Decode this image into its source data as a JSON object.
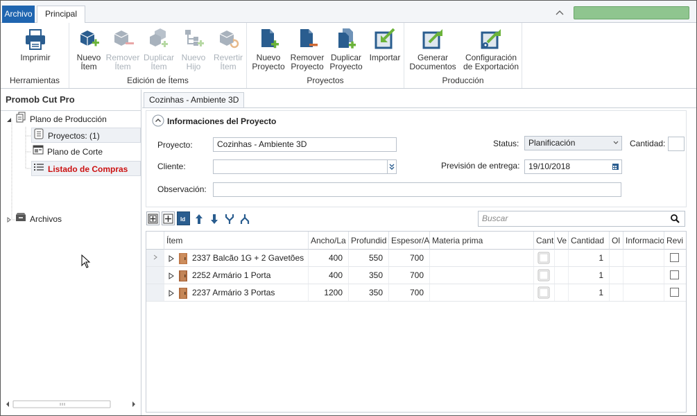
{
  "tabs": {
    "archivo": "Archivo",
    "principal": "Principal"
  },
  "ribbon": {
    "herramientas": {
      "label": "Herramientas",
      "imprimir": "Imprimir"
    },
    "edicion": {
      "label": "Edición de Ítems",
      "nuevo_item": [
        "Nuevo",
        "Ítem"
      ],
      "remover_item": [
        "Remover",
        "Ítem"
      ],
      "duplicar_item": [
        "Duplicar",
        "Ítem"
      ],
      "nuevo_hijo": [
        "Nuevo",
        "Hijo"
      ],
      "revertir_item": [
        "Revertir",
        "Ítem"
      ]
    },
    "proyectos": {
      "label": "Proyectos",
      "nuevo_proyecto": [
        "Nuevo",
        "Proyecto"
      ],
      "remover_proyecto": [
        "Remover",
        "Proyecto"
      ],
      "duplicar_proyecto": [
        "Duplicar",
        "Proyecto"
      ],
      "importar": "Importar"
    },
    "produccion": {
      "label": "Producción",
      "generar": [
        "Generar",
        "Documentos"
      ],
      "configuracion": [
        "Configuración",
        "de Exportación"
      ]
    }
  },
  "left": {
    "title": "Promob Cut Pro",
    "tree": {
      "plano_produccion": "Plano de Producción",
      "proyectos": "Proyectos: (1)",
      "plano_corte": "Plano de Corte",
      "listado": "Listado de Compras",
      "archivos": "Archivos"
    }
  },
  "main": {
    "doc_tab": "Cozinhas - Ambiente 3D",
    "panel_title": "Informaciones del Proyecto",
    "form": {
      "proyecto_label": "Proyecto:",
      "proyecto_value": "Cozinhas - Ambiente 3D",
      "cliente_label": "Cliente:",
      "cliente_value": "",
      "observacion_label": "Observación:",
      "observacion_value": "",
      "status_label": "Status:",
      "status_value": "Planificación",
      "prevision_label": "Previsión de entrega:",
      "prevision_value": "19/10/2018",
      "cantidad_label": "Cantidad:"
    },
    "search_placeholder": "Buscar",
    "grid": {
      "headers": [
        "Ítem",
        "Ancho/La",
        "Profundid",
        "Espesor/A",
        "Materia prima",
        "Cant",
        "Ve",
        "Cantidad",
        "Ol",
        "Informacio",
        "Revi"
      ],
      "rows": [
        {
          "code": "2337",
          "name": "Balcão 1G + 2 Gavetões",
          "ancho": "400",
          "prof": "550",
          "esp": "700",
          "cantidad": "1"
        },
        {
          "code": "2252",
          "name": "Armário 1 Porta",
          "ancho": "400",
          "prof": "350",
          "esp": "700",
          "cantidad": "1"
        },
        {
          "code": "2237",
          "name": "Armário 3 Portas",
          "ancho": "1200",
          "prof": "350",
          "esp": "700",
          "cantidad": "1"
        }
      ]
    }
  },
  "colors": {
    "accent": "#1f65b0",
    "icon_blue": "#2a5d8f",
    "icon_green": "#6bb33a",
    "red_text": "#cc1111",
    "status_green": "#8fc58f"
  }
}
